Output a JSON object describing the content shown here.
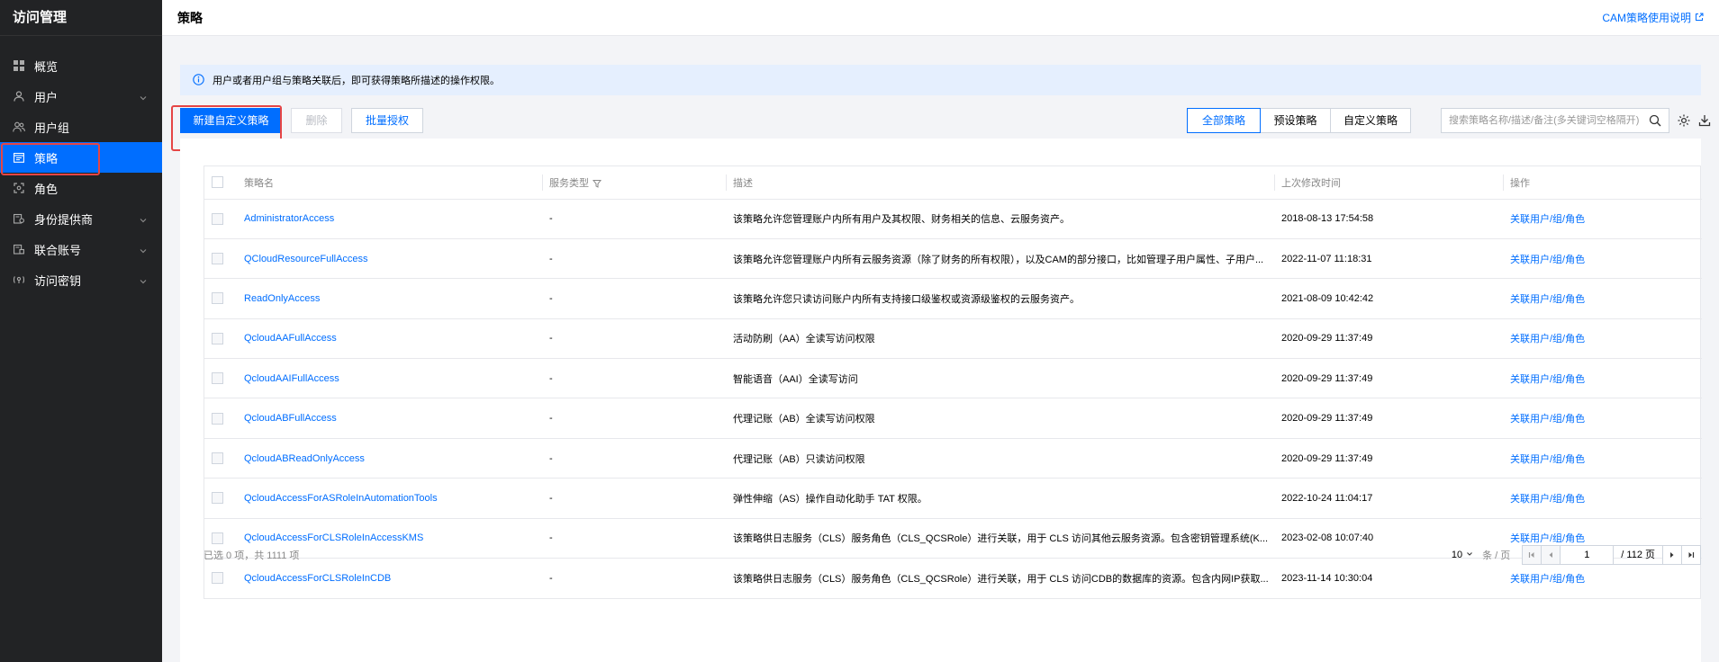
{
  "sidebar": {
    "title": "访问管理",
    "items": [
      {
        "label": "概览",
        "icon": "grid-icon",
        "chevron": false
      },
      {
        "label": "用户",
        "icon": "user-icon",
        "chevron": true
      },
      {
        "label": "用户组",
        "icon": "user-group-icon",
        "chevron": false
      },
      {
        "label": "策略",
        "icon": "policy-icon",
        "chevron": false,
        "active": true
      },
      {
        "label": "角色",
        "icon": "role-icon",
        "chevron": false
      },
      {
        "label": "身份提供商",
        "icon": "identity-provider-icon",
        "chevron": true
      },
      {
        "label": "联合账号",
        "icon": "federated-account-icon",
        "chevron": true
      },
      {
        "label": "访问密钥",
        "icon": "access-key-icon",
        "chevron": true
      }
    ]
  },
  "header": {
    "title": "策略",
    "doc_link": "CAM策略使用说明"
  },
  "info": {
    "text": "用户或者用户组与策略关联后，即可获得策略所描述的操作权限。"
  },
  "toolbar": {
    "create_label": "新建自定义策略",
    "delete_label": "删除",
    "batch_label": "批量授权",
    "filters": [
      "全部策略",
      "预设策略",
      "自定义策略"
    ],
    "active_filter": "全部策略",
    "search_placeholder": "搜索策略名称/描述/备注(多关键词空格隔开)"
  },
  "table": {
    "columns": [
      "策略名",
      "服务类型",
      "描述",
      "上次修改时间",
      "操作"
    ],
    "rows": [
      {
        "name": "AdministratorAccess",
        "service": "-",
        "desc": "该策略允许您管理账户内所有用户及其权限、财务相关的信息、云服务资产。",
        "time": "2018-08-13 17:54:58",
        "action": "关联用户/组/角色"
      },
      {
        "name": "QCloudResourceFullAccess",
        "service": "-",
        "desc": "该策略允许您管理账户内所有云服务资源（除了财务的所有权限），以及CAM的部分接口，比如管理子用户属性、子用户...",
        "time": "2022-11-07 11:18:31",
        "action": "关联用户/组/角色"
      },
      {
        "name": "ReadOnlyAccess",
        "service": "-",
        "desc": "该策略允许您只读访问账户内所有支持接口级鉴权或资源级鉴权的云服务资产。",
        "time": "2021-08-09 10:42:42",
        "action": "关联用户/组/角色"
      },
      {
        "name": "QcloudAAFullAccess",
        "service": "-",
        "desc": "活动防刷（AA）全读写访问权限",
        "time": "2020-09-29 11:37:49",
        "action": "关联用户/组/角色"
      },
      {
        "name": "QcloudAAIFullAccess",
        "service": "-",
        "desc": "智能语音（AAI）全读写访问",
        "time": "2020-09-29 11:37:49",
        "action": "关联用户/组/角色"
      },
      {
        "name": "QcloudABFullAccess",
        "service": "-",
        "desc": "代理记账（AB）全读写访问权限",
        "time": "2020-09-29 11:37:49",
        "action": "关联用户/组/角色"
      },
      {
        "name": "QcloudABReadOnlyAccess",
        "service": "-",
        "desc": "代理记账（AB）只读访问权限",
        "time": "2020-09-29 11:37:49",
        "action": "关联用户/组/角色"
      },
      {
        "name": "QcloudAccessForASRoleInAutomationTools",
        "service": "-",
        "desc": "弹性伸缩（AS）操作自动化助手 TAT 权限。",
        "time": "2022-10-24 11:04:17",
        "action": "关联用户/组/角色"
      },
      {
        "name": "QcloudAccessForCLSRoleInAccessKMS",
        "service": "-",
        "desc": "该策略供日志服务（CLS）服务角色（CLS_QCSRole）进行关联，用于 CLS 访问其他云服务资源。包含密钥管理系统(K...",
        "time": "2023-02-08 10:07:40",
        "action": "关联用户/组/角色"
      },
      {
        "name": "QcloudAccessForCLSRoleInCDB",
        "service": "-",
        "desc": "该策略供日志服务（CLS）服务角色（CLS_QCSRole）进行关联，用于 CLS 访问CDB的数据库的资源。包含内网IP获取...",
        "time": "2023-11-14 10:30:04",
        "action": "关联用户/组/角色"
      }
    ]
  },
  "footer": {
    "selection": "已选 0 项，共 1111 项",
    "page_size": "10",
    "page_size_unit": "条 / 页",
    "current_page": "1",
    "total_pages": "/ 112 页"
  },
  "colors": {
    "primary": "#006eff",
    "sidebar_bg": "#222325",
    "highlight": "#e54545"
  }
}
